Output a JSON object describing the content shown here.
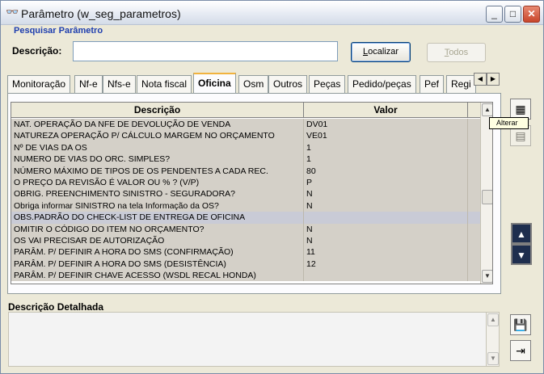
{
  "window": {
    "title": "Parâmetro (w_seg_parametros)",
    "icon": "glasses-icon"
  },
  "search": {
    "section_title": "Pesquisar Parâmetro",
    "label": "Descrição:",
    "value": "",
    "localizar_label": "Localizar",
    "todos_label": "Todos"
  },
  "tabs": [
    {
      "label": "Monitoração"
    },
    {
      "label": "Nf-e"
    },
    {
      "label": "Nfs-e"
    },
    {
      "label": "Nota fiscal"
    },
    {
      "label": "Oficina",
      "active": true
    },
    {
      "label": "Osm"
    },
    {
      "label": "Outros"
    },
    {
      "label": "Peças"
    },
    {
      "label": "Pedido/peças"
    },
    {
      "label": "Pef"
    },
    {
      "label": "Regi"
    }
  ],
  "grid": {
    "headers": {
      "descricao": "Descrição",
      "valor": "Valor"
    },
    "rows": [
      {
        "d": "NAT. OPERAÇÃO DA NFE DE DEVOLUÇÃO DE VENDA",
        "v": "DV01"
      },
      {
        "d": "NATUREZA OPERAÇÃO P/ CÁLCULO MARGEM NO ORÇAMENTO",
        "v": "VE01"
      },
      {
        "d": "Nº DE VIAS DA OS",
        "v": "1"
      },
      {
        "d": "NUMERO DE VIAS DO ORC. SIMPLES?",
        "v": "1"
      },
      {
        "d": "NÚMERO MÁXIMO DE TIPOS DE OS PENDENTES A CADA REC.",
        "v": "80"
      },
      {
        "d": "O PREÇO DA REVISÃO É VALOR OU % ? (V/P)",
        "v": "P"
      },
      {
        "d": "OBRIG. PREENCHIMENTO SINISTRO - SEGURADORA?",
        "v": "N"
      },
      {
        "d": "Obriga informar SINISTRO na tela Informação da OS?",
        "v": "N"
      },
      {
        "d": "OBS.PADRÃO DO CHECK-LIST DE ENTREGA DE OFICINA",
        "v": "",
        "selected": true
      },
      {
        "d": "OMITIR O CÓDIGO DO ITEM NO ORÇAMENTO?",
        "v": "N"
      },
      {
        "d": "OS VAI PRECISAR DE AUTORIZAÇÃO",
        "v": "N"
      },
      {
        "d": "PARÂM. P/ DEFINIR A HORA DO SMS (CONFIRMAÇÃO)",
        "v": "11"
      },
      {
        "d": "PARÂM. P/ DEFINIR A HORA DO SMS (DESISTÊNCIA)",
        "v": "12"
      },
      {
        "d": "PARÂM. P/ DEFINIR CHAVE ACESSO (WSDL RECAL HONDA)",
        "v": ""
      }
    ]
  },
  "tooltip": {
    "text": "Alterar"
  },
  "detail": {
    "label": "Descrição Detalhada",
    "value": ""
  }
}
